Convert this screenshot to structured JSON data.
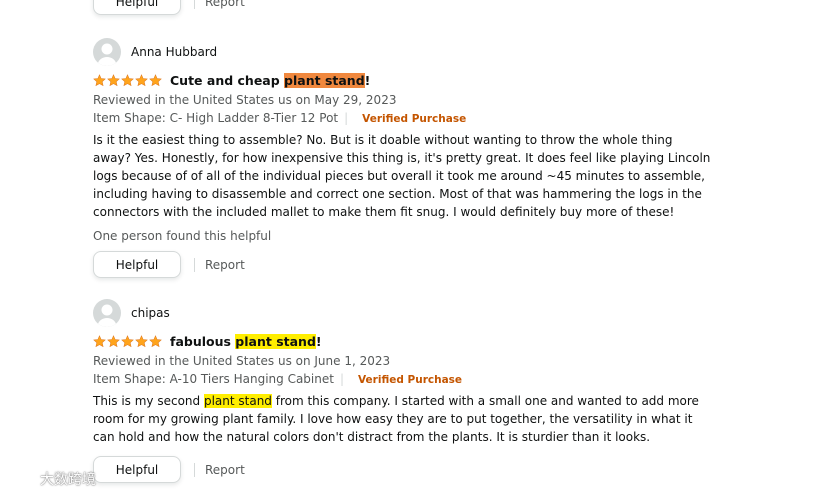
{
  "prev_review": {
    "helpful_label": "Helpful",
    "report_label": "Report"
  },
  "reviews": [
    {
      "reviewer": "Anna Hubbard",
      "title_pre": "Cute and cheap ",
      "title_highlight": "plant stand",
      "title_post": "!",
      "rating": 5,
      "date_line": "Reviewed in the United States us on May 29, 2023",
      "variant": "Item Shape: C- High Ladder 8-Tier 12 Pot",
      "verified": "Verified Purchase",
      "body_pre": "Is it the easiest thing to assemble? No. But is it doable without wanting to throw the whole thing away? Yes. Honestly, for how inexpensive this thing is, it's pretty great. It does feel like playing Lincoln logs because of of all of the individual pieces but overall it took me around ~45 minutes to assemble, including having to disassemble and correct one section. Most of that was hammering the logs in the connectors with the included mallet to make them fit snug. I would definitely buy more of these!",
      "body_highlight": "",
      "body_post": "",
      "helpful_count": "One person found this helpful",
      "helpful_label": "Helpful",
      "report_label": "Report"
    },
    {
      "reviewer": "chipas",
      "title_pre": "fabulous ",
      "title_highlight": "plant stand",
      "title_post": "!",
      "rating": 5,
      "date_line": "Reviewed in the United States us on June 1, 2023",
      "variant": "Item Shape: A-10 Tiers Hanging Cabinet",
      "verified": "Verified Purchase",
      "body_pre": "This is my second ",
      "body_highlight": "plant stand",
      "body_post": " from this company. I started with a small one and wanted to add more room for my growing plant family. I love how easy they are to put together, the versatility in what it can hold and how the natural colors don't distract from the plants. It is sturdier than it looks.",
      "helpful_count": "",
      "helpful_label": "Helpful",
      "report_label": "Report"
    }
  ],
  "watermark": {
    "text": "大数跨境"
  },
  "colors": {
    "star": "#ffa41c",
    "verified": "#c45500",
    "highlight_orange": "#f0883e",
    "highlight_yellow": "#ffee00"
  },
  "icons": {
    "avatar": "user-avatar-icon",
    "star": "star-icon"
  }
}
